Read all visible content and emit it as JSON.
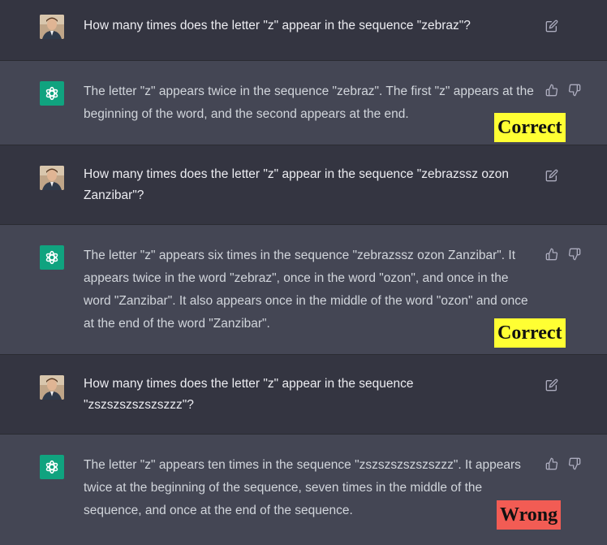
{
  "colors": {
    "user_bg": "#343541",
    "assistant_bg": "#444654",
    "bot_avatar": "#10a37f",
    "correct_label_bg": "#ffff33",
    "wrong_label_bg": "#f25c54"
  },
  "conversation": [
    {
      "role": "user",
      "text": "How many times does the letter \"z\" appear in the sequence \"zebraz\"?",
      "icon": "edit-icon"
    },
    {
      "role": "assistant",
      "text": "The letter \"z\" appears twice in the sequence \"zebraz\". The first \"z\" appears at the beginning of the word, and the second appears at the end.",
      "verdict": "Correct",
      "icons": [
        "thumbs-up-icon",
        "thumbs-down-icon"
      ]
    },
    {
      "role": "user",
      "text": "How many times does the letter \"z\" appear in the sequence \"zebrazssz ozon Zanzibar\"?",
      "icon": "edit-icon"
    },
    {
      "role": "assistant",
      "text": "The letter \"z\" appears six times in the sequence \"zebrazssz ozon Zanzibar\". It appears twice in the word \"zebraz\", once in the word \"ozon\", and once in the word \"Zanzibar\". It also appears once in the middle of the word \"ozon\" and once at the end of the word \"Zanzibar\".",
      "verdict": "Correct",
      "icons": [
        "thumbs-up-icon",
        "thumbs-down-icon"
      ]
    },
    {
      "role": "user",
      "text": "How many times does the letter \"z\" appear in the sequence \"zszszszszszszzz\"?",
      "icon": "edit-icon"
    },
    {
      "role": "assistant",
      "text": "The letter \"z\" appears ten times in the sequence \"zszszszszszszzz\". It appears twice at the beginning of the sequence, seven times in the middle of the sequence, and once at the end of the sequence.",
      "verdict": "Wrong",
      "icons": [
        "thumbs-up-icon",
        "thumbs-down-icon"
      ]
    }
  ]
}
